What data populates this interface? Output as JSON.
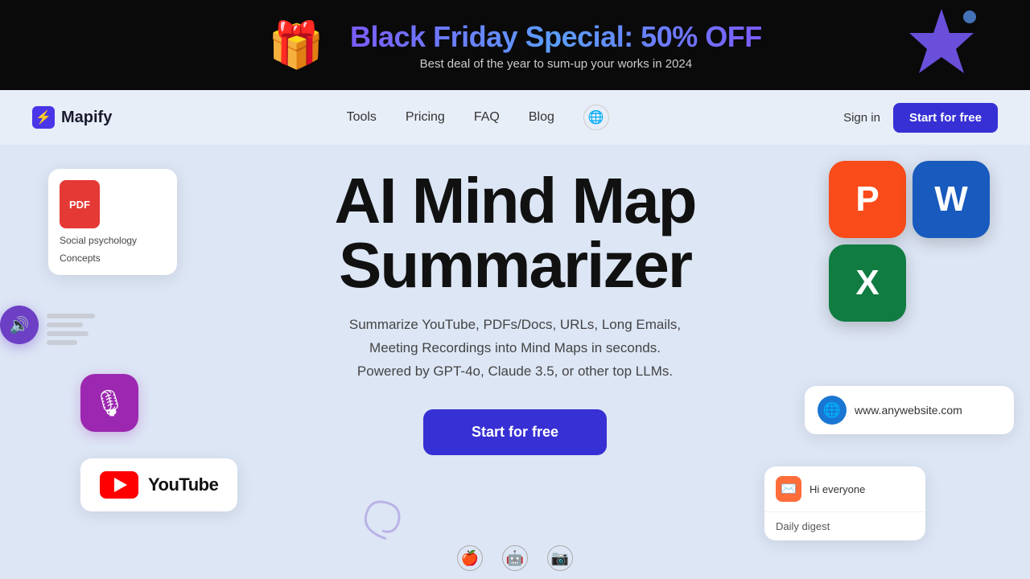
{
  "banner": {
    "title": "Black Friday Special: 50% OFF",
    "subtitle": "Best deal of the year to sum-up your works in 2024",
    "gift_emoji": "🎁",
    "star_emoji": "⭐"
  },
  "navbar": {
    "logo_text": "Mapify",
    "links": [
      {
        "label": "Tools",
        "id": "tools"
      },
      {
        "label": "Pricing",
        "id": "pricing"
      },
      {
        "label": "FAQ",
        "id": "faq"
      },
      {
        "label": "Blog",
        "id": "blog"
      }
    ],
    "signin_label": "Sign in",
    "start_label": "Start for free"
  },
  "hero": {
    "title_line1": "AI Mind Map",
    "title_line2": "Summarizer",
    "description": "Summarize YouTube, PDFs/Docs, URLs, Long Emails,\nMeeting Recordings into Mind Maps in seconds.\nPowered by GPT-4o, Claude 3.5, or other top LLMs.",
    "cta_label": "Start for free"
  },
  "floats": {
    "pdf_label": "PDF",
    "pdf_tag1": "Social psychology",
    "pdf_tag2": "Concepts",
    "youtube_text": "YouTube",
    "website_url": "www.anywebsite.com",
    "email_subject": "Hi everyone",
    "email_tag": "Daily digest",
    "ms_powerpoint": "P",
    "ms_word": "W",
    "ms_excel": "X"
  },
  "platforms": [
    "🍎",
    "🤖",
    "📷"
  ]
}
